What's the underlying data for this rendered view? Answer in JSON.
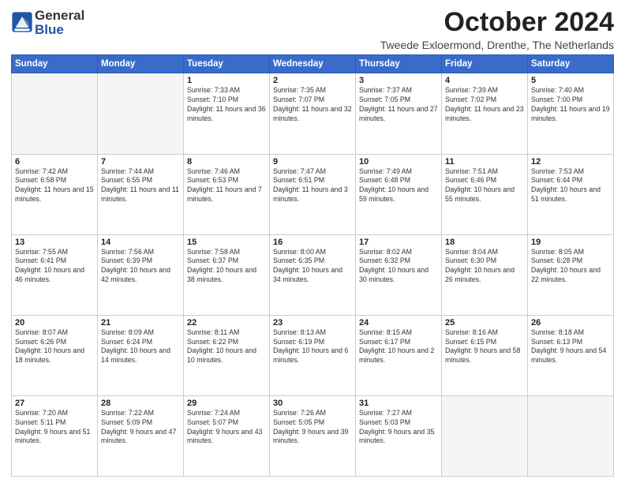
{
  "header": {
    "logo_general": "General",
    "logo_blue": "Blue",
    "month_title": "October 2024",
    "location": "Tweede Exloermond, Drenthe, The Netherlands"
  },
  "weekdays": [
    "Sunday",
    "Monday",
    "Tuesday",
    "Wednesday",
    "Thursday",
    "Friday",
    "Saturday"
  ],
  "weeks": [
    [
      {
        "day": "",
        "sunrise": "",
        "sunset": "",
        "daylight": ""
      },
      {
        "day": "",
        "sunrise": "",
        "sunset": "",
        "daylight": ""
      },
      {
        "day": "1",
        "sunrise": "Sunrise: 7:33 AM",
        "sunset": "Sunset: 7:10 PM",
        "daylight": "Daylight: 11 hours and 36 minutes."
      },
      {
        "day": "2",
        "sunrise": "Sunrise: 7:35 AM",
        "sunset": "Sunset: 7:07 PM",
        "daylight": "Daylight: 11 hours and 32 minutes."
      },
      {
        "day": "3",
        "sunrise": "Sunrise: 7:37 AM",
        "sunset": "Sunset: 7:05 PM",
        "daylight": "Daylight: 11 hours and 27 minutes."
      },
      {
        "day": "4",
        "sunrise": "Sunrise: 7:39 AM",
        "sunset": "Sunset: 7:02 PM",
        "daylight": "Daylight: 11 hours and 23 minutes."
      },
      {
        "day": "5",
        "sunrise": "Sunrise: 7:40 AM",
        "sunset": "Sunset: 7:00 PM",
        "daylight": "Daylight: 11 hours and 19 minutes."
      }
    ],
    [
      {
        "day": "6",
        "sunrise": "Sunrise: 7:42 AM",
        "sunset": "Sunset: 6:58 PM",
        "daylight": "Daylight: 11 hours and 15 minutes."
      },
      {
        "day": "7",
        "sunrise": "Sunrise: 7:44 AM",
        "sunset": "Sunset: 6:55 PM",
        "daylight": "Daylight: 11 hours and 11 minutes."
      },
      {
        "day": "8",
        "sunrise": "Sunrise: 7:46 AM",
        "sunset": "Sunset: 6:53 PM",
        "daylight": "Daylight: 11 hours and 7 minutes."
      },
      {
        "day": "9",
        "sunrise": "Sunrise: 7:47 AM",
        "sunset": "Sunset: 6:51 PM",
        "daylight": "Daylight: 11 hours and 3 minutes."
      },
      {
        "day": "10",
        "sunrise": "Sunrise: 7:49 AM",
        "sunset": "Sunset: 6:48 PM",
        "daylight": "Daylight: 10 hours and 59 minutes."
      },
      {
        "day": "11",
        "sunrise": "Sunrise: 7:51 AM",
        "sunset": "Sunset: 6:46 PM",
        "daylight": "Daylight: 10 hours and 55 minutes."
      },
      {
        "day": "12",
        "sunrise": "Sunrise: 7:53 AM",
        "sunset": "Sunset: 6:44 PM",
        "daylight": "Daylight: 10 hours and 51 minutes."
      }
    ],
    [
      {
        "day": "13",
        "sunrise": "Sunrise: 7:55 AM",
        "sunset": "Sunset: 6:41 PM",
        "daylight": "Daylight: 10 hours and 46 minutes."
      },
      {
        "day": "14",
        "sunrise": "Sunrise: 7:56 AM",
        "sunset": "Sunset: 6:39 PM",
        "daylight": "Daylight: 10 hours and 42 minutes."
      },
      {
        "day": "15",
        "sunrise": "Sunrise: 7:58 AM",
        "sunset": "Sunset: 6:37 PM",
        "daylight": "Daylight: 10 hours and 38 minutes."
      },
      {
        "day": "16",
        "sunrise": "Sunrise: 8:00 AM",
        "sunset": "Sunset: 6:35 PM",
        "daylight": "Daylight: 10 hours and 34 minutes."
      },
      {
        "day": "17",
        "sunrise": "Sunrise: 8:02 AM",
        "sunset": "Sunset: 6:32 PM",
        "daylight": "Daylight: 10 hours and 30 minutes."
      },
      {
        "day": "18",
        "sunrise": "Sunrise: 8:04 AM",
        "sunset": "Sunset: 6:30 PM",
        "daylight": "Daylight: 10 hours and 26 minutes."
      },
      {
        "day": "19",
        "sunrise": "Sunrise: 8:05 AM",
        "sunset": "Sunset: 6:28 PM",
        "daylight": "Daylight: 10 hours and 22 minutes."
      }
    ],
    [
      {
        "day": "20",
        "sunrise": "Sunrise: 8:07 AM",
        "sunset": "Sunset: 6:26 PM",
        "daylight": "Daylight: 10 hours and 18 minutes."
      },
      {
        "day": "21",
        "sunrise": "Sunrise: 8:09 AM",
        "sunset": "Sunset: 6:24 PM",
        "daylight": "Daylight: 10 hours and 14 minutes."
      },
      {
        "day": "22",
        "sunrise": "Sunrise: 8:11 AM",
        "sunset": "Sunset: 6:22 PM",
        "daylight": "Daylight: 10 hours and 10 minutes."
      },
      {
        "day": "23",
        "sunrise": "Sunrise: 8:13 AM",
        "sunset": "Sunset: 6:19 PM",
        "daylight": "Daylight: 10 hours and 6 minutes."
      },
      {
        "day": "24",
        "sunrise": "Sunrise: 8:15 AM",
        "sunset": "Sunset: 6:17 PM",
        "daylight": "Daylight: 10 hours and 2 minutes."
      },
      {
        "day": "25",
        "sunrise": "Sunrise: 8:16 AM",
        "sunset": "Sunset: 6:15 PM",
        "daylight": "Daylight: 9 hours and 58 minutes."
      },
      {
        "day": "26",
        "sunrise": "Sunrise: 8:18 AM",
        "sunset": "Sunset: 6:13 PM",
        "daylight": "Daylight: 9 hours and 54 minutes."
      }
    ],
    [
      {
        "day": "27",
        "sunrise": "Sunrise: 7:20 AM",
        "sunset": "Sunset: 5:11 PM",
        "daylight": "Daylight: 9 hours and 51 minutes."
      },
      {
        "day": "28",
        "sunrise": "Sunrise: 7:22 AM",
        "sunset": "Sunset: 5:09 PM",
        "daylight": "Daylight: 9 hours and 47 minutes."
      },
      {
        "day": "29",
        "sunrise": "Sunrise: 7:24 AM",
        "sunset": "Sunset: 5:07 PM",
        "daylight": "Daylight: 9 hours and 43 minutes."
      },
      {
        "day": "30",
        "sunrise": "Sunrise: 7:26 AM",
        "sunset": "Sunset: 5:05 PM",
        "daylight": "Daylight: 9 hours and 39 minutes."
      },
      {
        "day": "31",
        "sunrise": "Sunrise: 7:27 AM",
        "sunset": "Sunset: 5:03 PM",
        "daylight": "Daylight: 9 hours and 35 minutes."
      },
      {
        "day": "",
        "sunrise": "",
        "sunset": "",
        "daylight": ""
      },
      {
        "day": "",
        "sunrise": "",
        "sunset": "",
        "daylight": ""
      }
    ]
  ]
}
